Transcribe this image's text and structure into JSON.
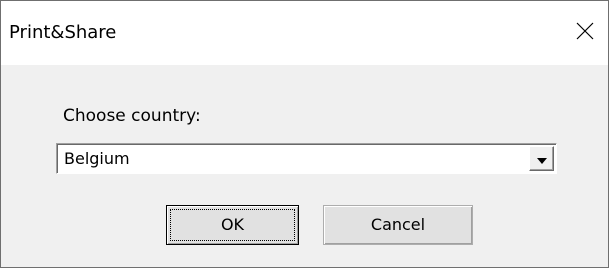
{
  "window": {
    "title": "Print&Share",
    "close_icon": "close-icon"
  },
  "form": {
    "label": "Choose country:",
    "country_select": {
      "value": "Belgium",
      "dropdown_icon": "chevron-down-icon"
    }
  },
  "buttons": {
    "ok_label": "OK",
    "cancel_label": "Cancel"
  },
  "colors": {
    "titlebar_bg": "#ffffff",
    "client_bg": "#f0f0f0",
    "button_bg": "#e1e1e1",
    "border": "#adadad"
  }
}
